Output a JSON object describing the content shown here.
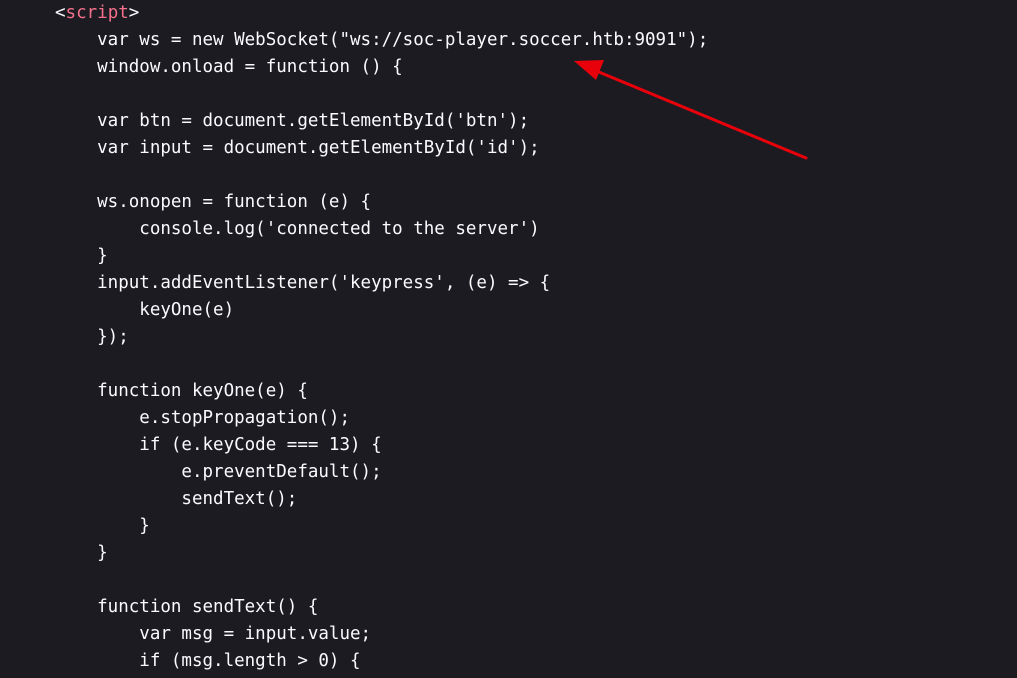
{
  "source_view": {
    "open_tag": {
      "bracket_open": "<",
      "name": "script",
      "bracket_close": ">"
    },
    "lines": [
      "    var ws = new WebSocket(\"ws://soc-player.soccer.htb:9091\");",
      "    window.onload = function () {",
      "",
      "    var btn = document.getElementById('btn');",
      "    var input = document.getElementById('id');",
      "",
      "    ws.onopen = function (e) {",
      "        console.log('connected to the server')",
      "    }",
      "    input.addEventListener('keypress', (e) => {",
      "        keyOne(e)",
      "    });",
      "",
      "    function keyOne(e) {",
      "        e.stopPropagation();",
      "        if (e.keyCode === 13) {",
      "            e.preventDefault();",
      "            sendText();",
      "        }",
      "    }",
      "",
      "    function sendText() {",
      "        var msg = input.value;",
      "        if (msg.length > 0) {"
    ]
  },
  "annotation": {
    "type": "arrow",
    "color": "#e8000b"
  },
  "colors": {
    "background": "#1c1b22",
    "text": "#fbfbfe",
    "tag_name": "#f5708a"
  }
}
